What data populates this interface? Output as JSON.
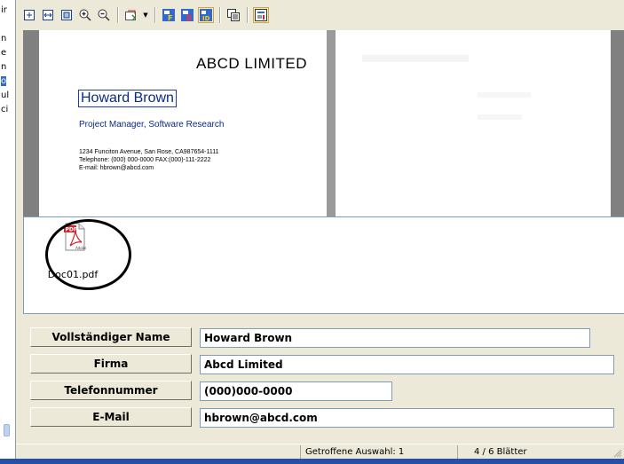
{
  "left_pane": {
    "fragments": [
      "ir",
      "n",
      "e",
      "n",
      "o",
      "ul",
      "ci"
    ]
  },
  "toolbar": {
    "buttons": [
      {
        "icon": "fit-page-icon"
      },
      {
        "icon": "fit-width-icon"
      },
      {
        "icon": "actual-size-icon"
      },
      {
        "icon": "zoom-in-icon"
      },
      {
        "icon": "zoom-out-icon"
      },
      {
        "icon": "scan-dropdown-icon"
      },
      {
        "icon": "front-side-icon",
        "letter": "F"
      },
      {
        "icon": "back-side-icon",
        "letter": "B"
      },
      {
        "icon": "id-card-icon",
        "letter": "ID"
      },
      {
        "icon": "copy-pages-icon"
      },
      {
        "icon": "info-icon"
      }
    ]
  },
  "business_card": {
    "company": "ABCD LIMITED",
    "name": "Howard Brown",
    "title": "Project Manager, Software Research",
    "address": "1234 Funciton Avenue, San Rose, CA987654-1111",
    "phone_line": "Telephone: (000) 000-0000  FAX:(000)-111-2222",
    "email_line": "E-mail: hbrown@abcd.com"
  },
  "thumbnails": {
    "document_label": "Doc01.pdf",
    "icon": "pdf-file-icon"
  },
  "form": {
    "fields": [
      {
        "label": "Vollständiger Name",
        "value": "Howard Brown"
      },
      {
        "label": "Firma",
        "value": "Abcd Limited"
      },
      {
        "label": "Telefonnummer",
        "value": "(000)000-0000"
      },
      {
        "label": "E-Mail",
        "value": "hbrown@abcd.com"
      }
    ]
  },
  "status_bar": {
    "selection": "Getroffene Auswahl:  1",
    "pages": "4 /   6 Blätter"
  },
  "colors": {
    "accent_blue": "#0b2a8a",
    "pdf_red": "#d2232a",
    "taskbar": "#2550a8"
  }
}
